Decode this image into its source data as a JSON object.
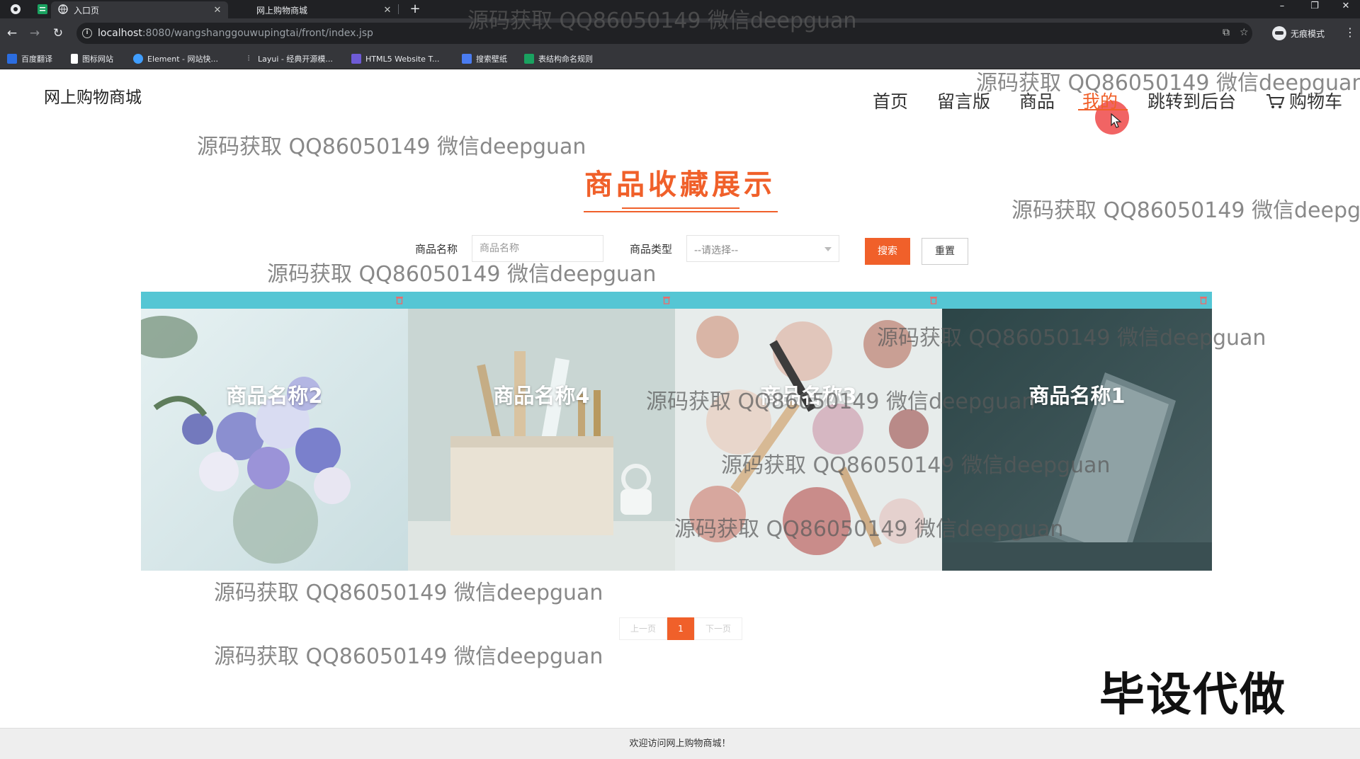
{
  "browser": {
    "tabs": [
      {
        "title": "入口页",
        "active": true
      },
      {
        "title": "网上购物商城",
        "active": false
      }
    ],
    "url_host": "localhost",
    "url_rest": ":8080/wangshanggouwupingtai/front/index.jsp",
    "incognito_label": "无痕模式",
    "bookmarks": [
      {
        "label": "百度翻译",
        "color": "#2b6de0"
      },
      {
        "label": "图标网站",
        "color": "#ffffff"
      },
      {
        "label": "Element - 网站快...",
        "color": "#409eff"
      },
      {
        "label": "Layui - 经典开源模...",
        "color": "#e8eaed"
      },
      {
        "label": "HTML5 Website T...",
        "color": "#6e5bd6"
      },
      {
        "label": "搜索壁纸",
        "color": "#4a7cf0"
      },
      {
        "label": "表结构命名规则",
        "color": "#1aa260"
      }
    ]
  },
  "site": {
    "title": "网上购物商城",
    "nav": [
      {
        "label": "首页",
        "active": false
      },
      {
        "label": "留言版",
        "active": false
      },
      {
        "label": "商品",
        "active": false
      },
      {
        "label": "我的",
        "active": true
      },
      {
        "label": "跳转到后台",
        "active": false
      },
      {
        "label": "购物车",
        "active": false
      }
    ]
  },
  "section": {
    "title": "商品收藏展示"
  },
  "search": {
    "name_label": "商品名称",
    "name_placeholder": "商品名称",
    "type_label": "商品类型",
    "type_value": "--请选择--",
    "search_button": "搜索",
    "reset_button": "重置"
  },
  "products": [
    {
      "name": "商品名称2",
      "image": "flowers"
    },
    {
      "name": "商品名称4",
      "image": "brushes"
    },
    {
      "name": "商品名称3",
      "image": "cosmetics"
    },
    {
      "name": "商品名称1",
      "image": "laptop"
    }
  ],
  "pagination": {
    "prev": "上一页",
    "current": "1",
    "next": "下一页"
  },
  "promo_text": "毕设代做",
  "footer_text": "欢迎访问网上购物商城！",
  "watermark_text": "源码获取 QQ86050149 微信deepguan",
  "colors": {
    "accent": "#f0602a",
    "card_bar": "#55c6d4",
    "footer_bg": "#eeeeee"
  }
}
